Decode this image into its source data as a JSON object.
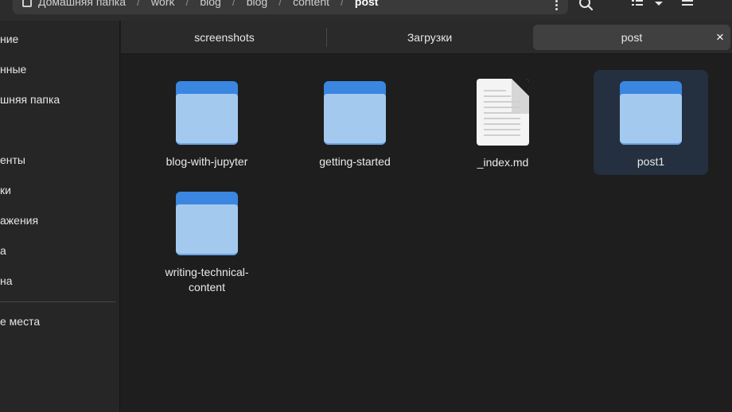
{
  "pathbar": {
    "segments": [
      "Домашняя папка",
      "work",
      "blog",
      "blog",
      "content",
      "post"
    ],
    "separator": "/"
  },
  "sidebar": {
    "items": [
      {
        "label": "ние"
      },
      {
        "label": "нные"
      },
      {
        "label": "шняя папка"
      },
      {
        "label": "енты"
      },
      {
        "label": "ки"
      },
      {
        "label": "ажения"
      },
      {
        "label": "а"
      },
      {
        "label": "на"
      },
      {
        "label": "е места"
      }
    ]
  },
  "tabs": [
    {
      "label": "screenshots"
    },
    {
      "label": "Загрузки"
    },
    {
      "label": "post",
      "active": true,
      "close": "×"
    }
  ],
  "files": [
    {
      "name": "blog-with-jupyter",
      "type": "folder"
    },
    {
      "name": "getting-started",
      "type": "folder"
    },
    {
      "name": "_index.md",
      "type": "document"
    },
    {
      "name": "post1",
      "type": "folder",
      "selected": true
    },
    {
      "name": "writing-technical-content",
      "type": "folder"
    }
  ],
  "colors": {
    "background": "#1e1e1e",
    "folder_back": "#3b86e0",
    "folder_front": "#a4c9ef",
    "selection": "#24303f"
  }
}
